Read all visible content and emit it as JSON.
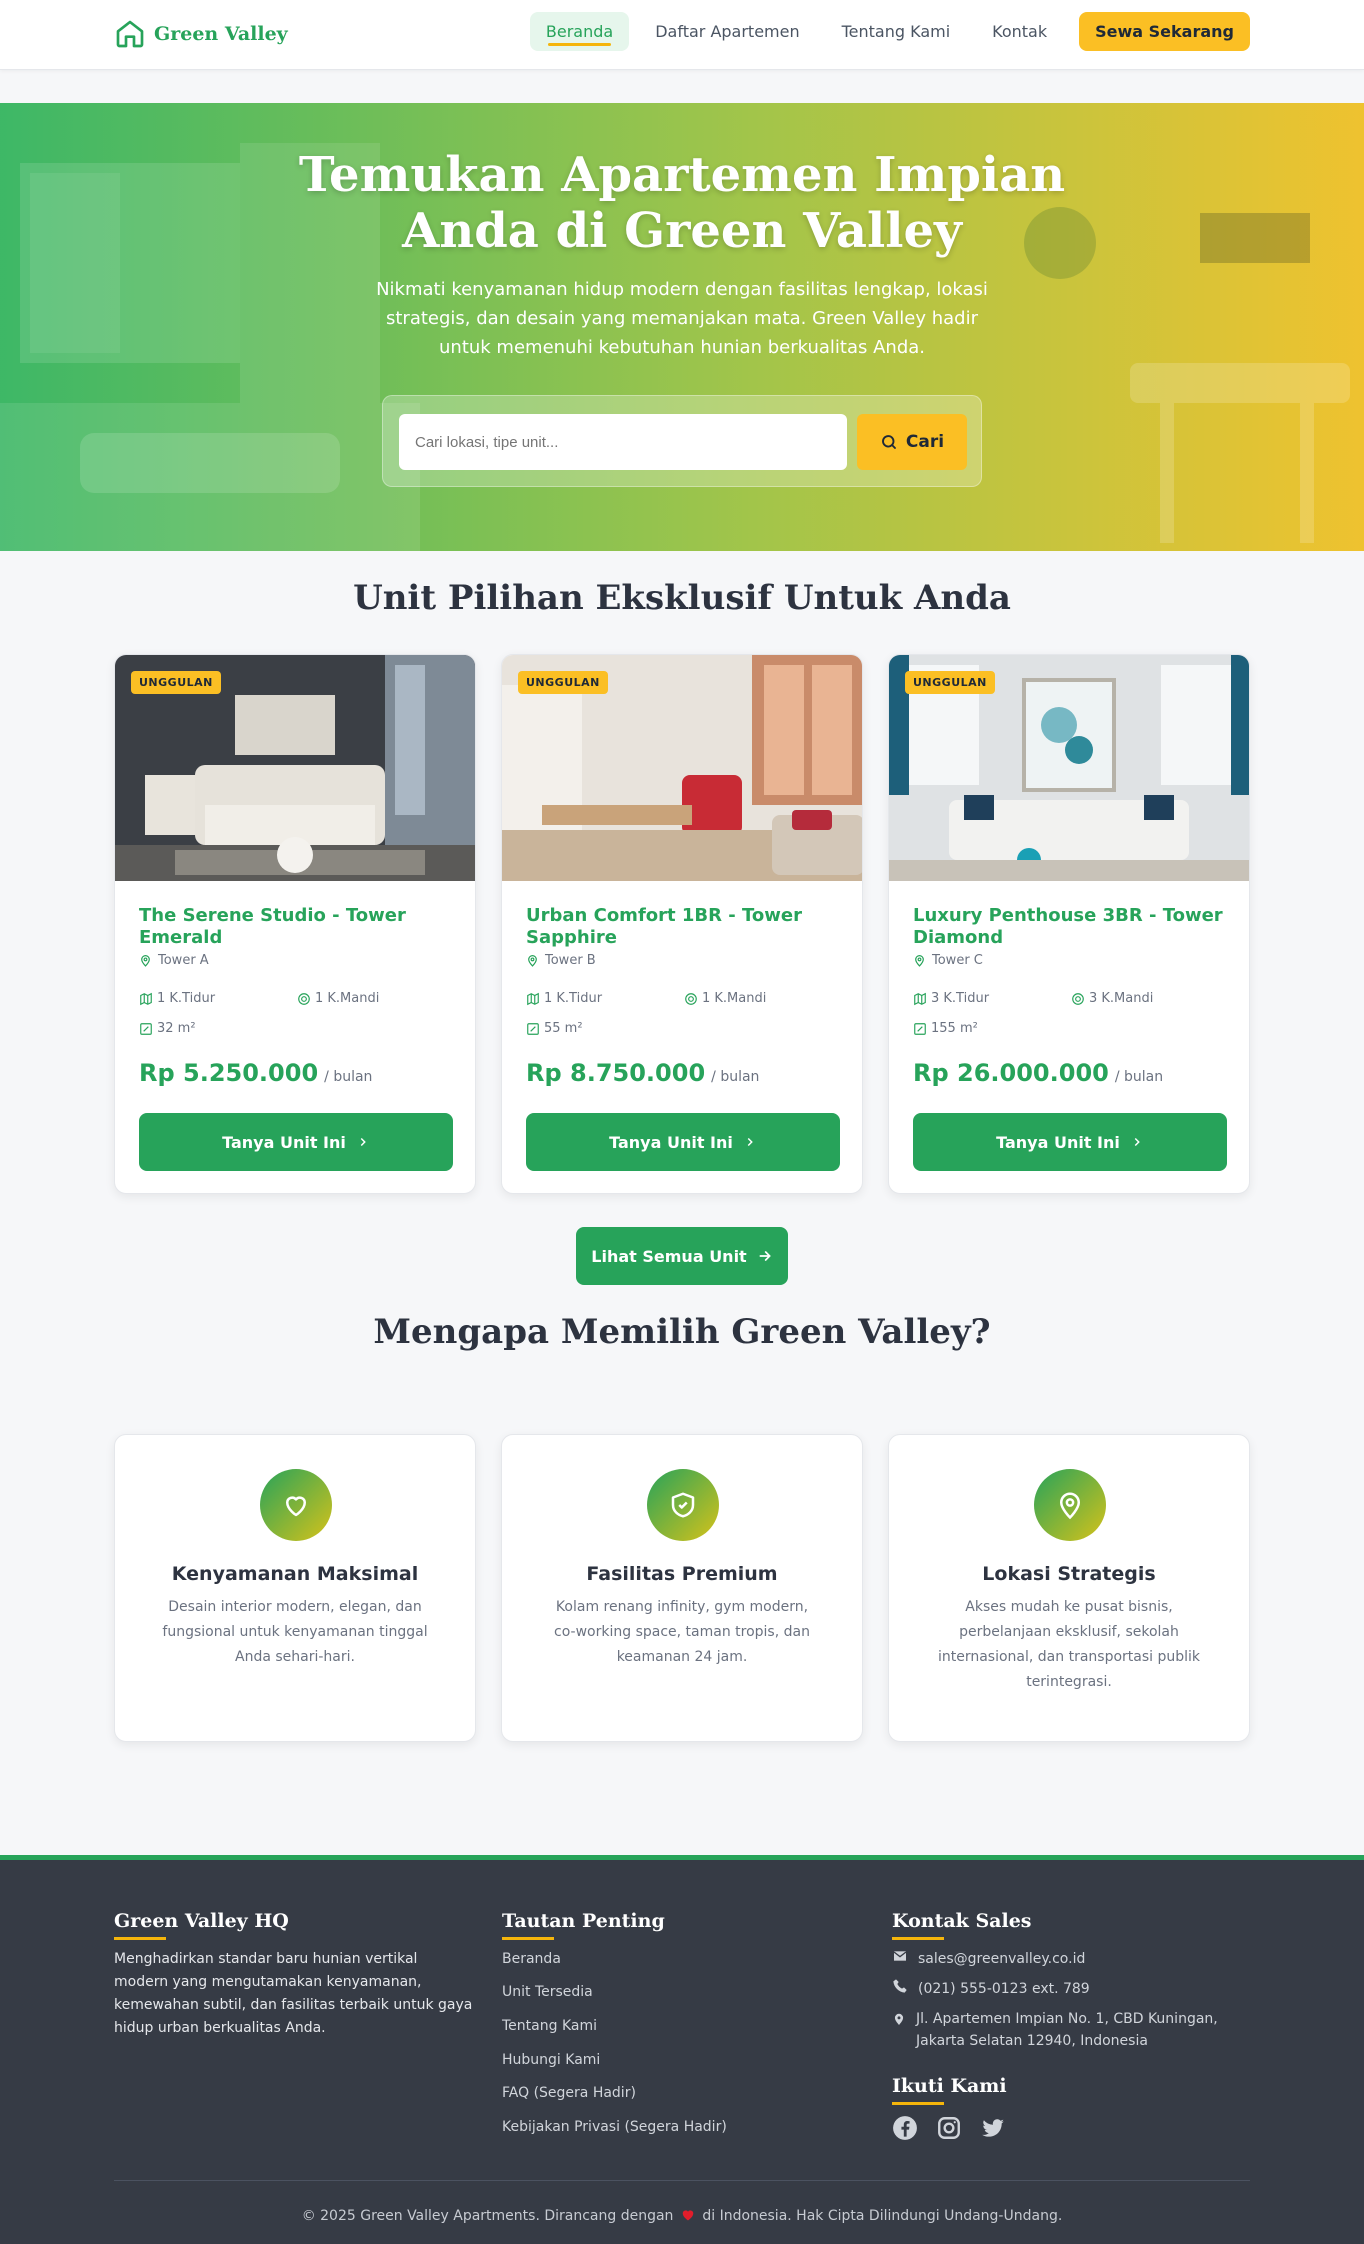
{
  "header": {
    "brand": "Green Valley",
    "nav": [
      "Beranda",
      "Daftar Apartemen",
      "Tentang Kami",
      "Kontak"
    ],
    "cta": "Sewa Sekarang"
  },
  "hero": {
    "title_line1": "Temukan Apartemen Impian",
    "title_line2": "Anda di Green Valley",
    "subtitle": "Nikmati kenyamanan hidup modern dengan fasilitas lengkap, lokasi strategis, dan desain yang memanjakan mata. Green Valley hadir untuk memenuhi kebutuhan hunian berkualitas Anda.",
    "search_placeholder": "Cari lokasi, tipe unit...",
    "search_button": "Cari"
  },
  "units_section": {
    "title": "Unit Pilihan Eksklusif Untuk Anda",
    "cards": [
      {
        "badge": "UNGGULAN",
        "title": "The Serene Studio - Tower Emerald",
        "tower": "Tower A",
        "bedrooms": "1 K.Tidur",
        "bathrooms": "1 K.Mandi",
        "area": "32 m²",
        "price": "Rp 5.250.000",
        "unit": "/ bulan",
        "button": "Tanya Unit Ini"
      },
      {
        "badge": "UNGGULAN",
        "title": "Urban Comfort 1BR - Tower Sapphire",
        "tower": "Tower B",
        "bedrooms": "1 K.Tidur",
        "bathrooms": "1 K.Mandi",
        "area": "55 m²",
        "price": "Rp 8.750.000",
        "unit": "/ bulan",
        "button": "Tanya Unit Ini"
      },
      {
        "badge": "UNGGULAN",
        "title": "Luxury Penthouse 3BR - Tower Diamond",
        "tower": "Tower C",
        "bedrooms": "3 K.Tidur",
        "bathrooms": "3 K.Mandi",
        "area": "155 m²",
        "price": "Rp 26.000.000",
        "unit": "/ bulan",
        "button": "Tanya Unit Ini"
      }
    ],
    "see_all": "Lihat Semua Unit"
  },
  "why_section": {
    "title": "Mengapa Memilih Green Valley?",
    "items": [
      {
        "icon": "heart-icon",
        "title": "Kenyamanan Maksimal",
        "desc": "Desain interior modern, elegan, dan fungsional untuk kenyamanan tinggal Anda sehari-hari."
      },
      {
        "icon": "shield-icon",
        "title": "Fasilitas Premium",
        "desc": "Kolam renang infinity, gym modern, co-working space, taman tropis, dan keamanan 24 jam."
      },
      {
        "icon": "map-pin-icon",
        "title": "Lokasi Strategis",
        "desc": "Akses mudah ke pusat bisnis, perbelanjaan eksklusif, sekolah internasional, dan transportasi publik terintegrasi."
      }
    ]
  },
  "footer": {
    "about_title": "Green Valley HQ",
    "about_text": "Menghadirkan standar baru hunian vertikal modern yang mengutamakan kenyamanan, kemewahan subtil, dan fasilitas terbaik untuk gaya hidup urban berkualitas Anda.",
    "links_title": "Tautan Penting",
    "links": [
      "Beranda",
      "Unit Tersedia",
      "Tentang Kami",
      "Hubungi Kami",
      "FAQ (Segera Hadir)",
      "Kebijakan Privasi (Segera Hadir)"
    ],
    "contact_title": "Kontak Sales",
    "email": "sales@greenvalley.co.id",
    "phone": "(021) 555-0123 ext. 789",
    "address": "Jl. Apartemen Impian No. 1, CBD Kuningan, Jakarta Selatan 12940, Indonesia",
    "follow_title": "Ikuti Kami",
    "social": [
      "facebook-icon",
      "instagram-icon",
      "twitter-icon"
    ],
    "copyright_pre": "© 2025 Green Valley Apartments. Dirancang dengan",
    "copyright_post": "di Indonesia. Hak Cipta Dilindungi Undang-Undang."
  },
  "colors": {
    "primary": "#27a35a",
    "accent": "#fbbf24",
    "footer": "#363b45"
  }
}
